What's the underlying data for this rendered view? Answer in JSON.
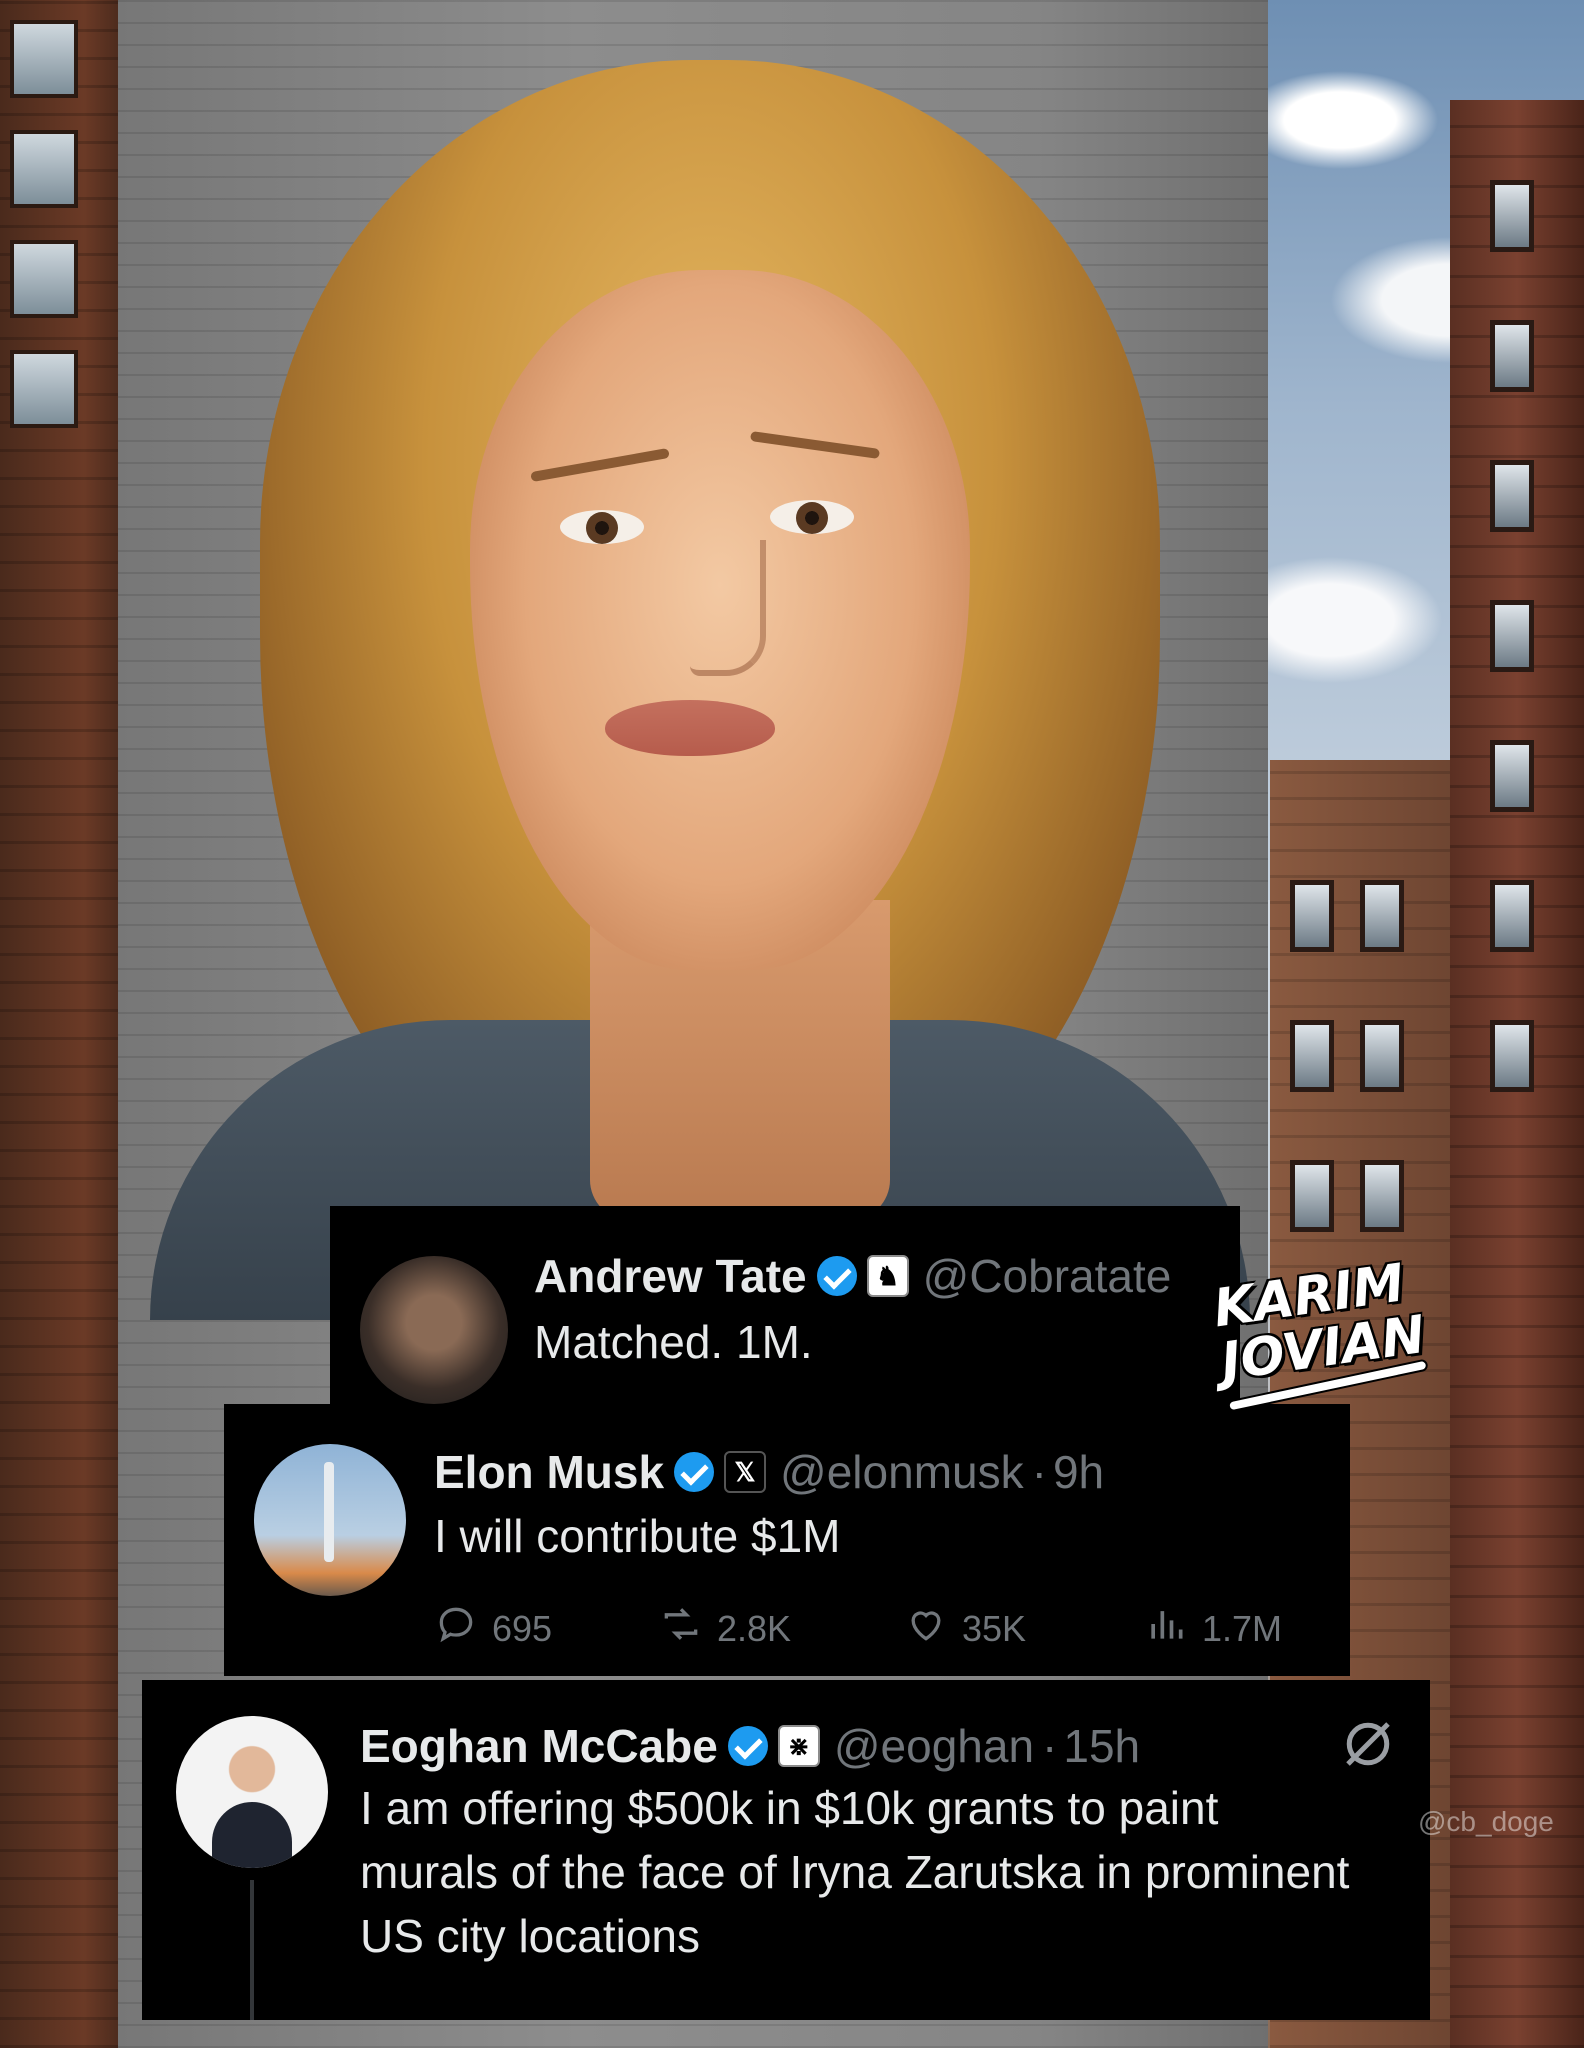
{
  "tweets": [
    {
      "display_name": "Andrew Tate",
      "affiliation_icon": "chess-knight-icon",
      "handle": "@Cobratate",
      "text": "Matched. 1M."
    },
    {
      "display_name": "Elon Musk",
      "affiliation_icon": "x-logo-icon",
      "affiliation_glyph": "𝕏",
      "handle": "@elonmusk",
      "time": "9h",
      "text": "I will contribute $1M",
      "stats": {
        "replies": "695",
        "reposts": "2.8K",
        "likes": "35K",
        "views": "1.7M"
      }
    },
    {
      "display_name": "Eoghan McCabe",
      "affiliation_icon": "intercom-logo-icon",
      "affiliation_glyph": "⋇",
      "handle": "@eoghan",
      "time": "15h",
      "text": "I am offering $500k in $10k grants to paint murals of the face of Iryna Zarutska in prominent US city locations"
    }
  ],
  "watermark": {
    "line1": "KARIM",
    "line2": "JOVIAN"
  },
  "credit": "@cb_doge",
  "colors": {
    "card_bg": "#000000",
    "text": "#e7e9ea",
    "muted": "#71767b",
    "verified": "#1d9bf0"
  }
}
